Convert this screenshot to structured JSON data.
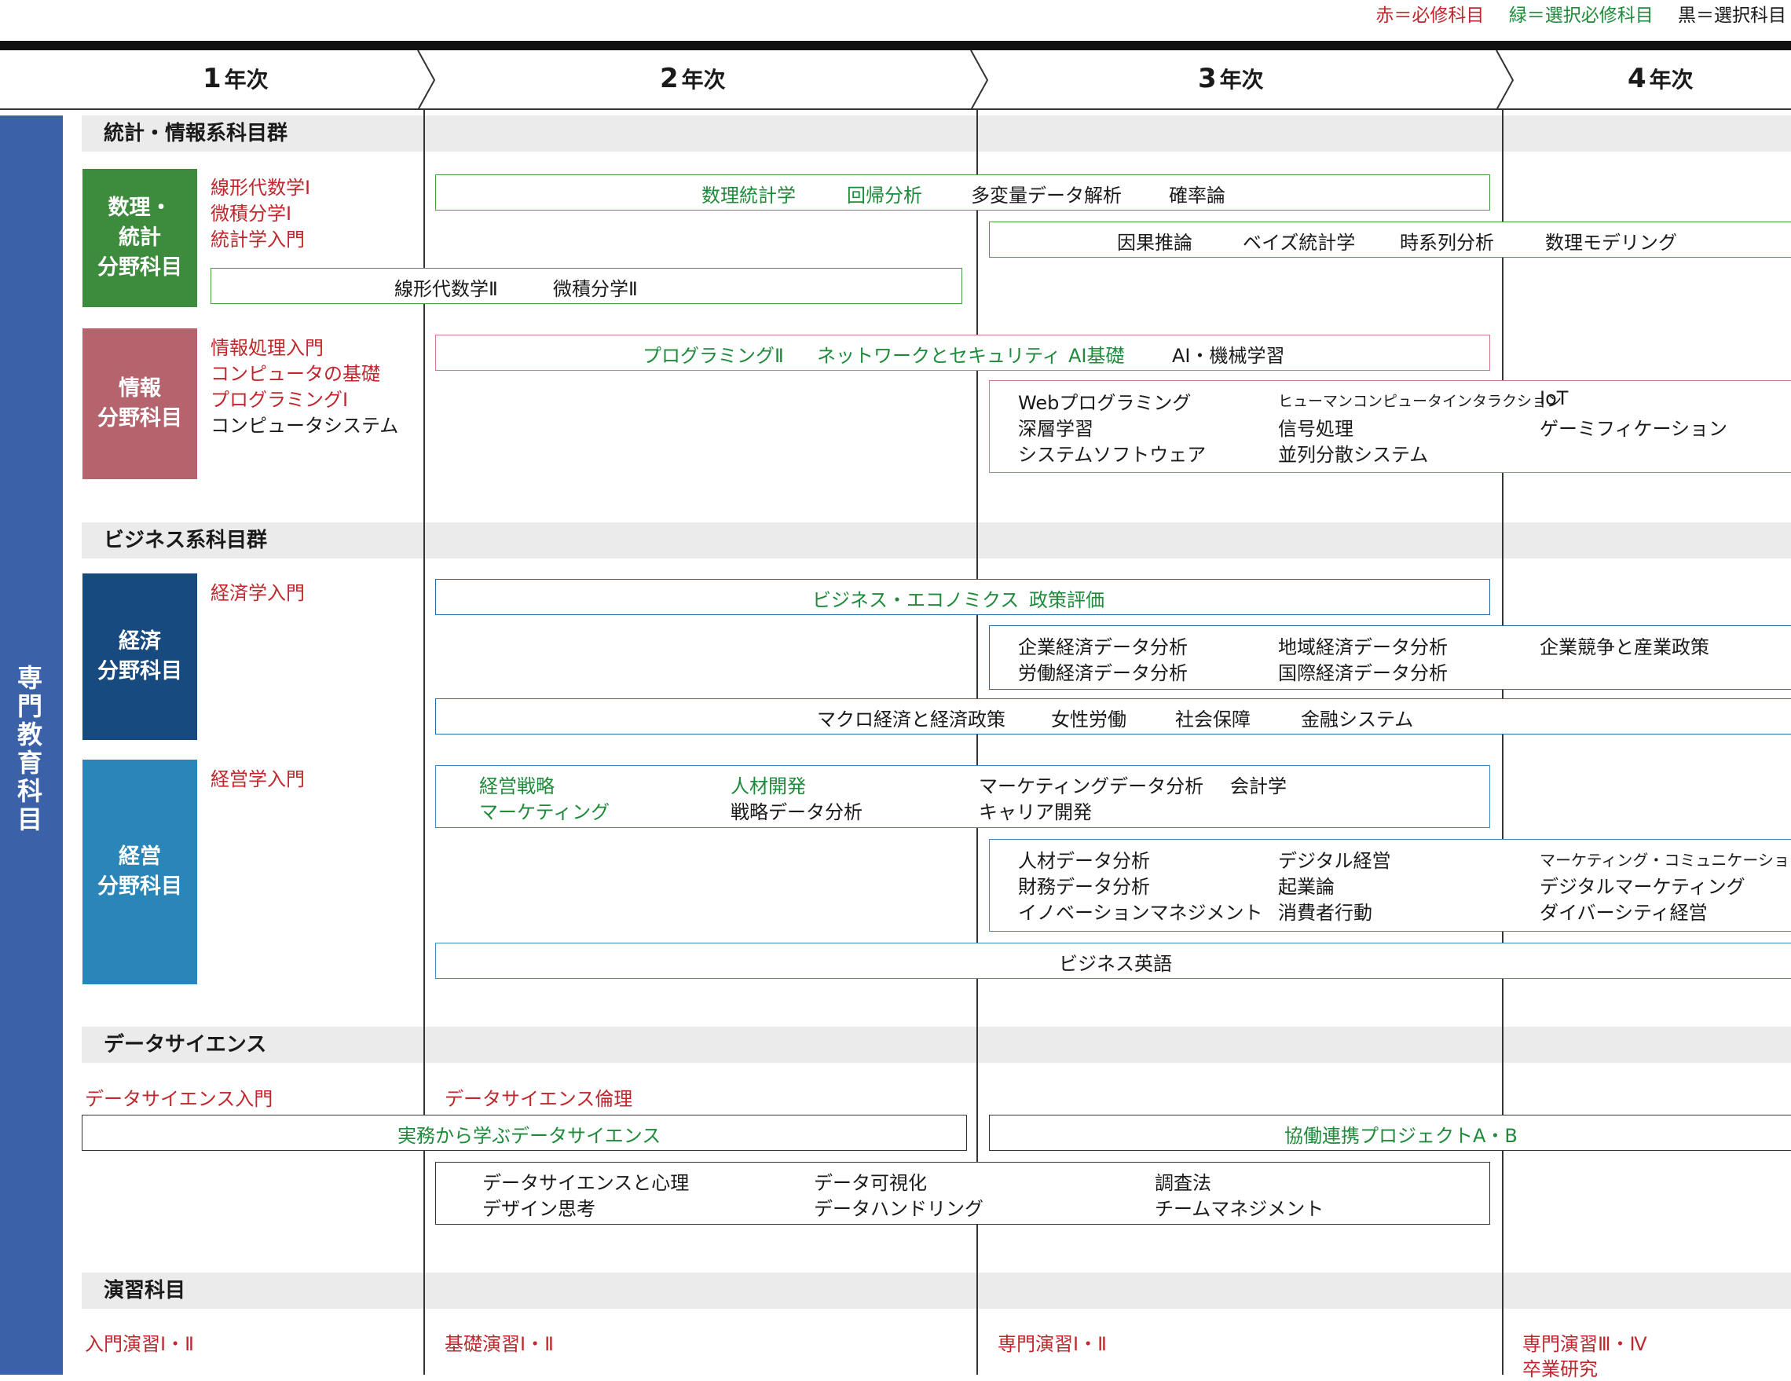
{
  "legend": {
    "red": "赤＝必修科目",
    "green": "緑＝選択必修科目",
    "black": "黒＝選択科目"
  },
  "years": [
    {
      "num": "1",
      "suffix": "年次"
    },
    {
      "num": "2",
      "suffix": "年次"
    },
    {
      "num": "3",
      "suffix": "年次"
    },
    {
      "num": "4",
      "suffix": "年次"
    }
  ],
  "sidebar_label": "専門教育科目",
  "sections": {
    "stats_info": "統計・情報系科目群",
    "business": "ビジネス系科目群",
    "ds": "データサイエンス",
    "practice": "演習科目"
  },
  "blocks": {
    "math_line1": "数理・",
    "math_line2": "統計",
    "math_line3": "分野科目",
    "info_line1": "情報",
    "info_line2": "分野科目",
    "econ_line1": "経済",
    "econ_line2": "分野科目",
    "mgmt_line1": "経営",
    "mgmt_line2": "分野科目"
  },
  "math": {
    "req1": "線形代数学Ⅰ",
    "req2": "微積分学Ⅰ",
    "req3": "統計学入門",
    "y2_g1": "数理統計学",
    "y2_g2": "回帰分析",
    "y2_b1": "多変量データ解析",
    "y2_b2": "確率論",
    "y3_1": "因果推論",
    "y3_2": "ベイズ統計学",
    "y3_3": "時系列分析",
    "y3_4": "数理モデリング",
    "y1_1": "線形代数学Ⅱ",
    "y1_2": "微積分学Ⅱ"
  },
  "info": {
    "req1": "情報処理入門",
    "req2": "コンピュータの基礎",
    "req3": "プログラミングⅠ",
    "opt1": "コンピュータシステム",
    "y2_g1": "プログラミングⅡ",
    "y2_g2": "ネットワークとセキュリティ",
    "y2_g3": "AI基礎",
    "y2_b1": "AI・機械学習",
    "y3_c1a": "Webプログラミング",
    "y3_c1b": "深層学習",
    "y3_c1c": "システムソフトウェア",
    "y3_c2a": "ヒューマンコンピュータインタラクション",
    "y3_c2b": "信号処理",
    "y3_c2c": "並列分散システム",
    "y3_c3a": "IoT",
    "y3_c3b": "ゲーミフィケーション"
  },
  "econ": {
    "req1": "経済学入門",
    "y2_g1": "ビジネス・エコノミクス",
    "y2_g2": "政策評価",
    "y3_c1a": "企業経済データ分析",
    "y3_c1b": "労働経済データ分析",
    "y3_c2a": "地域経済データ分析",
    "y3_c2b": "国際経済データ分析",
    "y3_c3a": "企業競争と産業政策",
    "all_1": "マクロ経済と経済政策",
    "all_2": "女性労働",
    "all_3": "社会保障",
    "all_4": "金融システム"
  },
  "mgmt": {
    "req1": "経営学入門",
    "y2_g1": "経営戦略",
    "y2_g2": "マーケティング",
    "y2_g3": "人材開発",
    "y2_b1": "戦略データ分析",
    "y2_b2": "マーケティングデータ分析",
    "y2_b3": "キャリア開発",
    "y2_b4": "会計学",
    "y3_c1a": "人材データ分析",
    "y3_c1b": "財務データ分析",
    "y3_c1c": "イノベーションマネジメント",
    "y3_c2a": "デジタル経営",
    "y3_c2b": "起業論",
    "y3_c2c": "消費者行動",
    "y3_c3a": "マーケティング・コミュニケーション",
    "y3_c3b": "デジタルマーケティング",
    "y3_c3c": "ダイバーシティ経営",
    "all_1": "ビジネス英語"
  },
  "ds": {
    "req1": "データサイエンス入門",
    "req2": "データサイエンス倫理",
    "g1": "実務から学ぶデータサイエンス",
    "g2": "協働連携プロジェクトA・B",
    "b1": "データサイエンスと心理",
    "b2": "デザイン思考",
    "b3": "データ可視化",
    "b4": "データハンドリング",
    "b5": "調査法",
    "b6": "チームマネジメント"
  },
  "practice": {
    "y1": "入門演習Ⅰ・Ⅱ",
    "y2": "基礎演習Ⅰ・Ⅱ",
    "y3": "専門演習Ⅰ・Ⅱ",
    "y4a": "専門演習Ⅲ・Ⅳ",
    "y4b": "卒業研究"
  },
  "colors": {
    "required": "#c0272d",
    "elective_required": "#1e8a3a",
    "math_block": "#3d8b3d",
    "info_block": "#b5646e",
    "econ_block": "#174a7e",
    "mgmt_block": "#2a86b8",
    "sidebar": "#3b62a8",
    "section_bg": "#ebebeb"
  }
}
